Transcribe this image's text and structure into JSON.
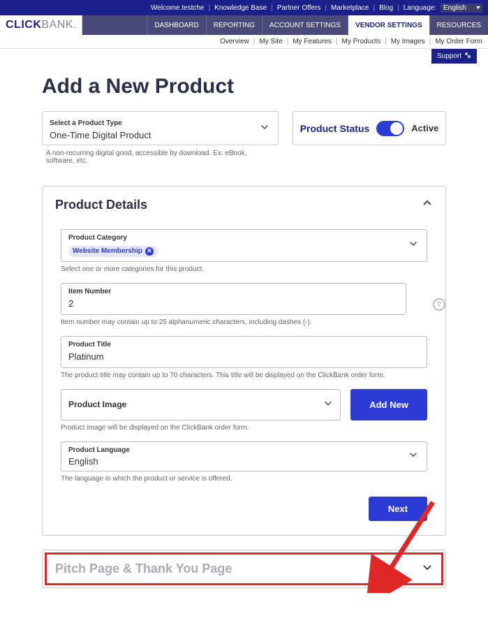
{
  "topbar": {
    "welcome": "Welcome.testche",
    "knowledge": "Knowledge Base",
    "partner": "Partner Offers",
    "marketplace": "Marketplace",
    "blog": "Blog",
    "language_label": "Language:",
    "language_value": "English"
  },
  "logo": {
    "part1": "CLICK",
    "part2": "BANK",
    "dot": "."
  },
  "main_nav": [
    {
      "label": "DASHBOARD",
      "active": false
    },
    {
      "label": "REPORTING",
      "active": false
    },
    {
      "label": "ACCOUNT SETTINGS",
      "active": false
    },
    {
      "label": "VENDOR SETTINGS",
      "active": true
    },
    {
      "label": "RESOURCES",
      "active": false
    }
  ],
  "sub_nav": [
    "Overview",
    "My Site",
    "My Features",
    "My Products",
    "My Images",
    "My Order Form"
  ],
  "support_label": "Support",
  "page_title": "Add a New Product",
  "product_type": {
    "label": "Select a Product Type",
    "value": "One-Time Digital Product",
    "help": "A non-recurring digital good, accessible by download. Ex: eBook, software, etc."
  },
  "status": {
    "label": "Product Status",
    "text": "Active"
  },
  "details": {
    "title": "Product Details",
    "category": {
      "label": "Product Category",
      "chip": "Website Membership",
      "help": "Select one or more categories for this product."
    },
    "item_number": {
      "label": "Item Number",
      "value": "2",
      "help": "Item number may contain up to 25 alphanumeric characters, including dashes (-)."
    },
    "product_title": {
      "label": "Product Title",
      "value": "Platinum",
      "help": "The product title may contain up to 70 characters. This title will be displayed on the ClickBank order form."
    },
    "product_image": {
      "label": "Product Image",
      "add_new": "Add New",
      "help": "Product image will be displayed on the ClickBank order form."
    },
    "product_language": {
      "label": "Product Language",
      "value": "English",
      "help": "The language in which the product or service is offered."
    },
    "next": "Next"
  },
  "pitch_panel": {
    "title": "Pitch Page & Thank You Page"
  }
}
